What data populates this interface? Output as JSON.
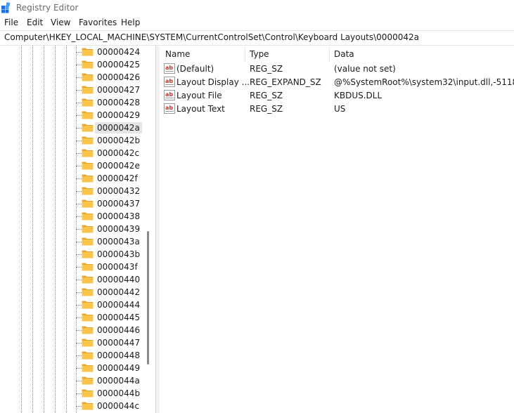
{
  "window": {
    "title": "Registry Editor",
    "app_icon": "registry-editor-icon"
  },
  "menu": {
    "items": [
      "File",
      "Edit",
      "View",
      "Favorites",
      "Help"
    ]
  },
  "address": {
    "path": "Computer\\HKEY_LOCAL_MACHINE\\SYSTEM\\CurrentControlSet\\Control\\Keyboard Layouts\\0000042a"
  },
  "tree": {
    "folder_icon": "folder-icon",
    "items": [
      {
        "label": "00000424"
      },
      {
        "label": "00000425"
      },
      {
        "label": "00000426"
      },
      {
        "label": "00000427"
      },
      {
        "label": "00000428"
      },
      {
        "label": "00000429"
      },
      {
        "label": "0000042a",
        "selected": true
      },
      {
        "label": "0000042b"
      },
      {
        "label": "0000042c"
      },
      {
        "label": "0000042e"
      },
      {
        "label": "0000042f"
      },
      {
        "label": "00000432"
      },
      {
        "label": "00000437"
      },
      {
        "label": "00000438"
      },
      {
        "label": "00000439"
      },
      {
        "label": "0000043a"
      },
      {
        "label": "0000043b"
      },
      {
        "label": "0000043f"
      },
      {
        "label": "00000440"
      },
      {
        "label": "00000442"
      },
      {
        "label": "00000444"
      },
      {
        "label": "00000445"
      },
      {
        "label": "00000446"
      },
      {
        "label": "00000447"
      },
      {
        "label": "00000448"
      },
      {
        "label": "00000449"
      },
      {
        "label": "0000044a"
      },
      {
        "label": "0000044b"
      },
      {
        "label": "0000044c"
      }
    ]
  },
  "values": {
    "columns": {
      "name": "Name",
      "type": "Type",
      "data": "Data"
    },
    "icon": "string-value-icon",
    "rows": [
      {
        "name": "(Default)",
        "type": "REG_SZ",
        "data": "(value not set)"
      },
      {
        "name": "Layout Display ...",
        "type": "REG_EXPAND_SZ",
        "data": "@%SystemRoot%\\system32\\input.dll,-5118"
      },
      {
        "name": "Layout File",
        "type": "REG_SZ",
        "data": "KBDUS.DLL"
      },
      {
        "name": "Layout Text",
        "type": "REG_SZ",
        "data": "US"
      }
    ]
  },
  "colors": {
    "folder_yellow": "#f8c44b",
    "folder_dark": "#e8a72a",
    "selection_bg": "#e5e5e5",
    "reg_icon_red": "#c0392b"
  }
}
